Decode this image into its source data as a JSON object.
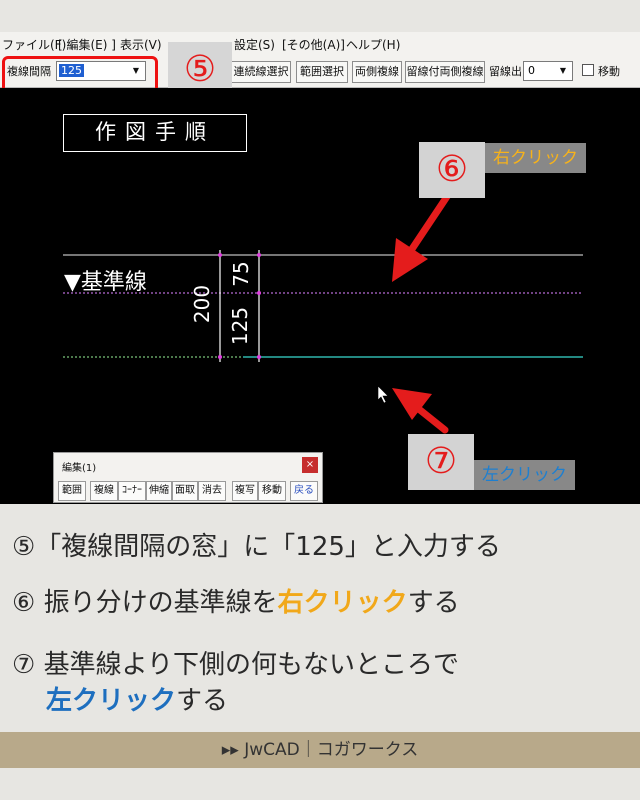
{
  "menu": {
    "file": "ファイル(F)",
    "edit": "[ 編集(E) ]",
    "view": "表示(V)",
    "settings": "設定(S)",
    "other": "[その他(A)]",
    "help": "ヘルプ(H)"
  },
  "toolbar": {
    "offset_label": "複線間隔",
    "offset_value": "125",
    "chain_select": "連続線選択",
    "range_select": "範囲選択",
    "both_sides": "両側複線",
    "trim_both_sides": "留線付両側複線",
    "trim_out_label": "留線出",
    "trim_out_value": "0",
    "move_label": "移動"
  },
  "callouts": {
    "step5": "⑤",
    "step6": "⑥",
    "step7": "⑦",
    "right_click": "右クリック",
    "left_click": "左クリック"
  },
  "canvas": {
    "title": "作図手順",
    "baseline_label": "▼基準線",
    "dim_total": "200",
    "dim_upper": "75",
    "dim_lower": "125"
  },
  "palette": {
    "title": "編集(1)",
    "close": "×",
    "buttons": [
      "範囲",
      "複線",
      "ｺｰﾅｰ",
      "伸縮",
      "面取",
      "消去",
      "複写",
      "移動",
      "戻る"
    ]
  },
  "instructions": {
    "step5_text": "⑤「複線間隔の窓」に「125」と入力する",
    "step6_pre": "⑥ 振り分けの基準線を",
    "step6_hl": "右クリック",
    "step6_post": "する",
    "step7_line1": "⑦ 基準線より下側の何もないところで",
    "step7_hl": "左クリック",
    "step7_post": "する"
  },
  "footer": "▸▸ JwCAD｜コガワークス",
  "colors": {
    "callout_red": "#e41c1c",
    "right_click": "#f6b21b",
    "left_click": "#1e7fd0",
    "canvas_bg": "#000000",
    "footer_bg": "#b8a98a"
  }
}
